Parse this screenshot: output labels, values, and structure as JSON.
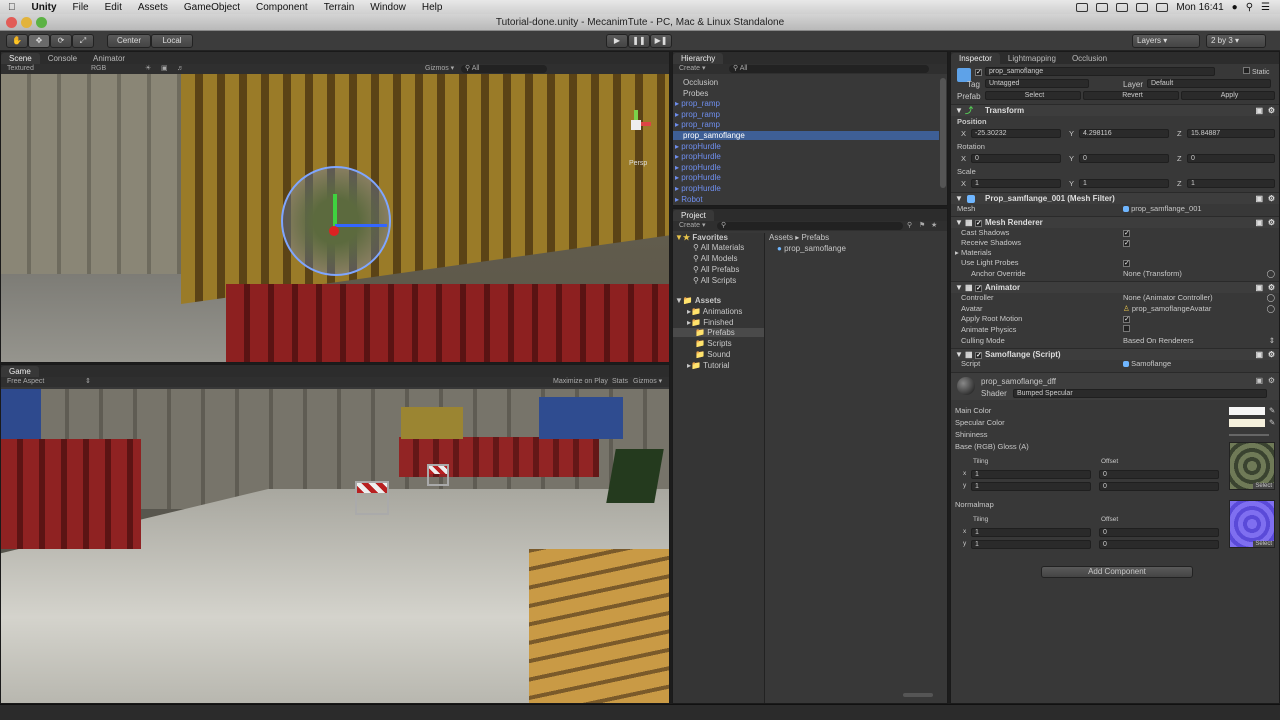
{
  "menubar": {
    "app": "Unity",
    "items": [
      "File",
      "Edit",
      "Assets",
      "GameObject",
      "Component",
      "Terrain",
      "Window",
      "Help"
    ],
    "clock": "Mon 16:41"
  },
  "window_title": "Tutorial-done.unity - MecanimTute - PC, Mac & Linux Standalone",
  "toolbar": {
    "pivot": "Center",
    "space": "Local",
    "layers": "Layers",
    "layout": "2 by 3"
  },
  "scene": {
    "tabs": [
      "Scene",
      "Console",
      "Animator"
    ],
    "draw_mode": "Textured",
    "render_mode": "RGB",
    "gizmos": "Gizmos ▾",
    "search": "All",
    "persp": "Persp"
  },
  "game": {
    "tab": "Game",
    "aspect": "Free Aspect",
    "maximize": "Maximize on Play",
    "stats": "Stats",
    "gizmos": "Gizmos ▾"
  },
  "hierarchy": {
    "tab": "Hierarchy",
    "create": "Create ▾",
    "search": "All",
    "items": [
      {
        "label": "Occlusion",
        "cls": ""
      },
      {
        "label": "Probes",
        "cls": ""
      },
      {
        "label": "prop_ramp",
        "cls": "blue",
        "arrow": true
      },
      {
        "label": "prop_ramp",
        "cls": "blue",
        "arrow": true
      },
      {
        "label": "prop_ramp",
        "cls": "blue",
        "arrow": true
      },
      {
        "label": "prop_samoflange",
        "cls": "blue sel"
      },
      {
        "label": "propHurdle",
        "cls": "blue",
        "arrow": true
      },
      {
        "label": "propHurdle",
        "cls": "blue",
        "arrow": true
      },
      {
        "label": "propHurdle",
        "cls": "blue",
        "arrow": true
      },
      {
        "label": "propHurdle",
        "cls": "blue",
        "arrow": true
      },
      {
        "label": "propHurdle",
        "cls": "blue",
        "arrow": true
      },
      {
        "label": "Robot",
        "cls": "blue",
        "arrow": true
      }
    ]
  },
  "project": {
    "tab": "Project",
    "create": "Create ▾",
    "favorites_label": "Favorites",
    "favorites": [
      "All Materials",
      "All Models",
      "All Prefabs",
      "All Scripts"
    ],
    "assets_label": "Assets",
    "folders": [
      "Animations",
      "Finished",
      "Prefabs",
      "Scripts",
      "Sound",
      "Tutorial"
    ],
    "breadcrumb_root": "Assets",
    "breadcrumb_sep": "▸",
    "breadcrumb_leaf": "Prefabs",
    "files": [
      "prop_samoflange"
    ]
  },
  "inspector": {
    "tabs": [
      "Inspector",
      "Lightmapping",
      "Occlusion"
    ],
    "object_name": "prop_samoflange",
    "static": "Static",
    "tag_label": "Tag",
    "tag_value": "Untagged",
    "layer_label": "Layer",
    "layer_value": "Default",
    "prefab_label": "Prefab",
    "prefab_select": "Select",
    "prefab_revert": "Revert",
    "prefab_apply": "Apply",
    "transform": {
      "title": "Transform",
      "position_label": "Position",
      "rotation_label": "Rotation",
      "scale_label": "Scale",
      "pos": [
        "-25.30232",
        "4.298116",
        "15.84887"
      ],
      "rot": [
        "0",
        "0",
        "0"
      ],
      "scale": [
        "1",
        "1",
        "1"
      ]
    },
    "mesh_filter": {
      "title": "Prop_samflange_001 (Mesh Filter)",
      "mesh_label": "Mesh",
      "mesh_value": "prop_samflange_001"
    },
    "mesh_renderer": {
      "title": "Mesh Renderer",
      "cast": "Cast Shadows",
      "receive": "Receive Shadows",
      "materials": "Materials",
      "probes": "Use Light Probes",
      "anchor": "Anchor Override",
      "anchor_value": "None (Transform)"
    },
    "animator": {
      "title": "Animator",
      "controller": "Controller",
      "controller_value": "None (Animator Controller)",
      "avatar": "Avatar",
      "avatar_value": "prop_samoflangeAvatar",
      "root": "Apply Root Motion",
      "physics": "Animate Physics",
      "culling": "Culling Mode",
      "culling_value": "Based On Renderers"
    },
    "script": {
      "title": "Samoflange (Script)",
      "label": "Script",
      "value": "Samoflange"
    },
    "material": {
      "name": "prop_samoflange_dff",
      "shader_label": "Shader",
      "shader_value": "Bumped Specular",
      "main_color": "Main Color",
      "spec_color": "Specular Color",
      "shininess": "Shininess",
      "base": "Base (RGB) Gloss (A)",
      "normalmap": "Normalmap",
      "tiling": "Tiling",
      "offset": "Offset",
      "tx": "1",
      "ty": "1",
      "ox": "0",
      "oy": "0",
      "select": "Select"
    },
    "add_component": "Add Component"
  },
  "colors": {
    "selection": "#3e5f96",
    "prefab_blue": "#6f8ff0",
    "panel": "#383838"
  }
}
